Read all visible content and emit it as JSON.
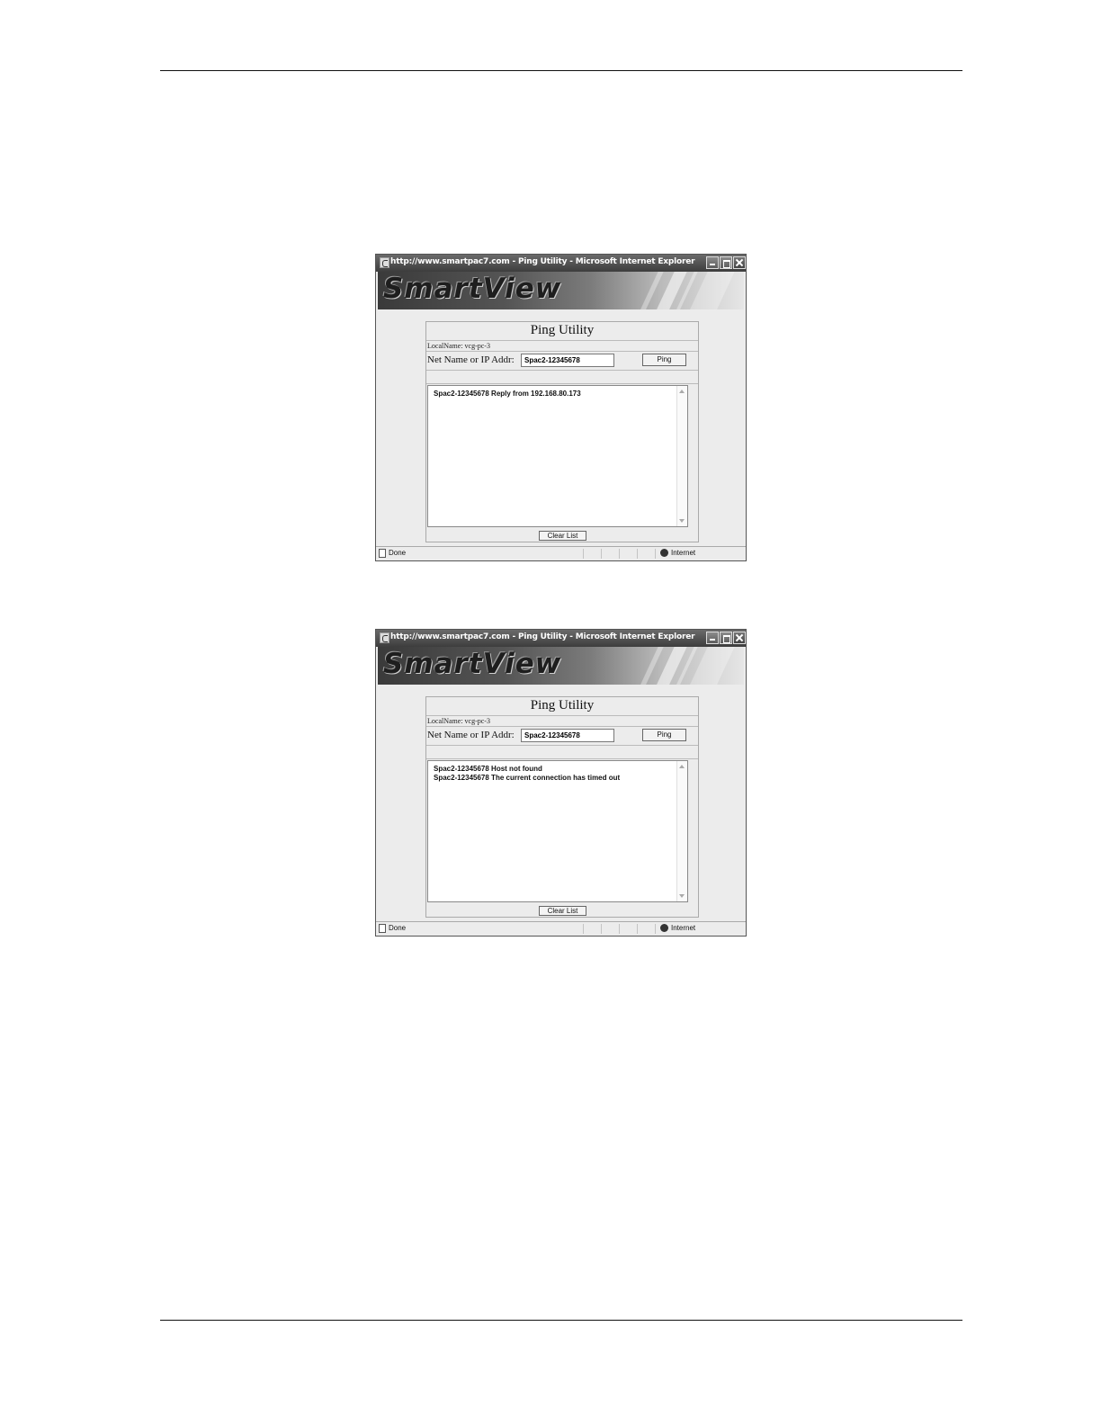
{
  "windows": [
    {
      "title": "http://www.smartpac7.com - Ping Utility - Microsoft Internet Explorer",
      "brand": "SmartView",
      "panel_title": "Ping Utility",
      "local_name": "LocalName: vcg-pc-3",
      "net_label": "Net Name or IP Addr:",
      "input_value": "Spac2-12345678",
      "ping_label": "Ping",
      "results": [
        "Spac2-12345678 Reply from 192.168.80.173"
      ],
      "clear_label": "Clear List",
      "status": "Done",
      "zone": "Internet"
    },
    {
      "title": "http://www.smartpac7.com - Ping Utility - Microsoft Internet Explorer",
      "brand": "SmartView",
      "panel_title": "Ping Utility",
      "local_name": "LocalName: vcg-pc-3",
      "net_label": "Net Name or IP Addr:",
      "input_value": "Spac2-12345678",
      "ping_label": "Ping",
      "results": [
        "Spac2-12345678 Host not found",
        "Spac2-12345678 The current connection has timed out"
      ],
      "clear_label": "Clear List",
      "status": "Done",
      "zone": "Internet"
    }
  ]
}
